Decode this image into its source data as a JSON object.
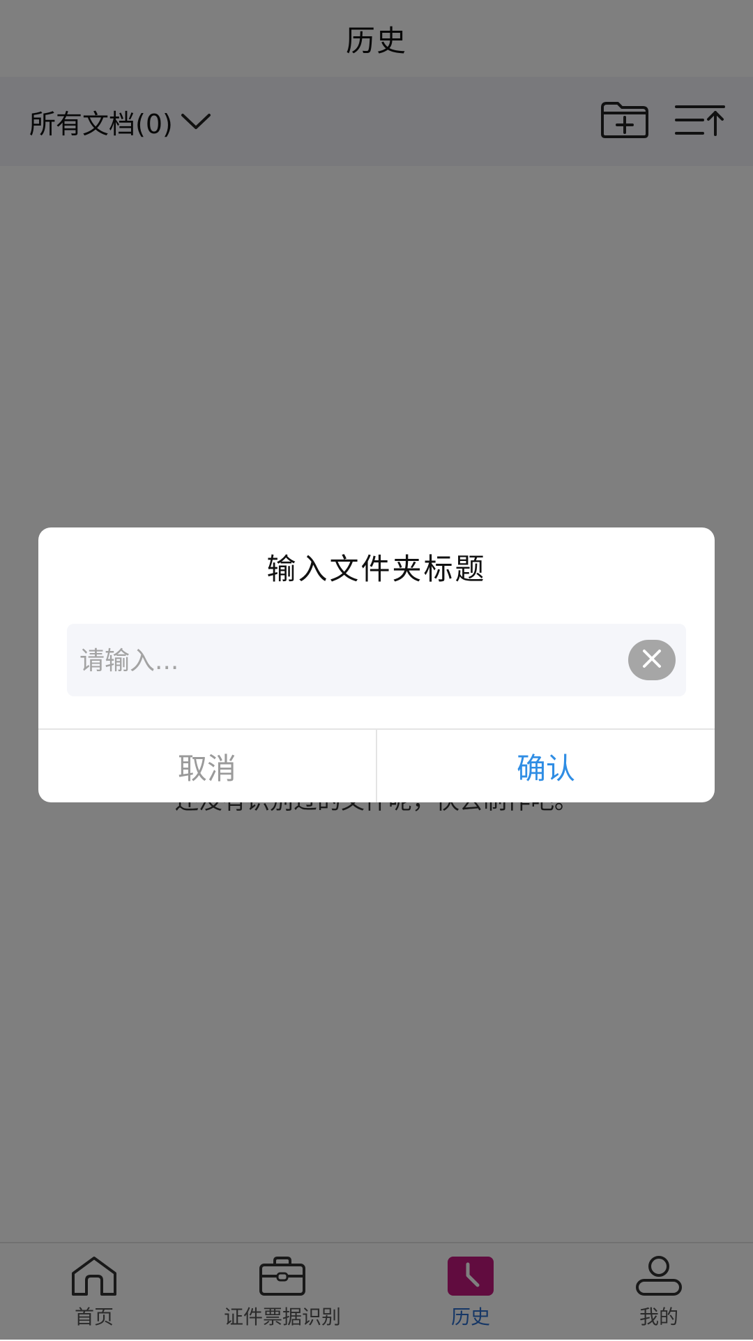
{
  "header": {
    "title": "历史"
  },
  "toolbar": {
    "filter_label": "所有文档(0)",
    "new_folder_icon": "folder-plus-icon",
    "sort_icon": "sort-ascending-icon"
  },
  "empty_hint": "还没有识别过的文件呢，快去制作吧。",
  "dialog": {
    "title": "输入文件夹标题",
    "input_placeholder": "请输入...",
    "input_value": "",
    "cancel_label": "取消",
    "confirm_label": "确认"
  },
  "bottom_nav": {
    "items": [
      {
        "label": "首页",
        "icon": "home-icon"
      },
      {
        "label": "证件票据识别",
        "icon": "briefcase-icon"
      },
      {
        "label": "历史",
        "icon": "clock-icon"
      },
      {
        "label": "我的",
        "icon": "user-icon"
      }
    ]
  },
  "colors": {
    "accent": "#2f8de4",
    "active_nav": "#2d6fcd",
    "history_icon": "#c2187e",
    "overlay": "rgba(0,0,0,0.5)"
  }
}
